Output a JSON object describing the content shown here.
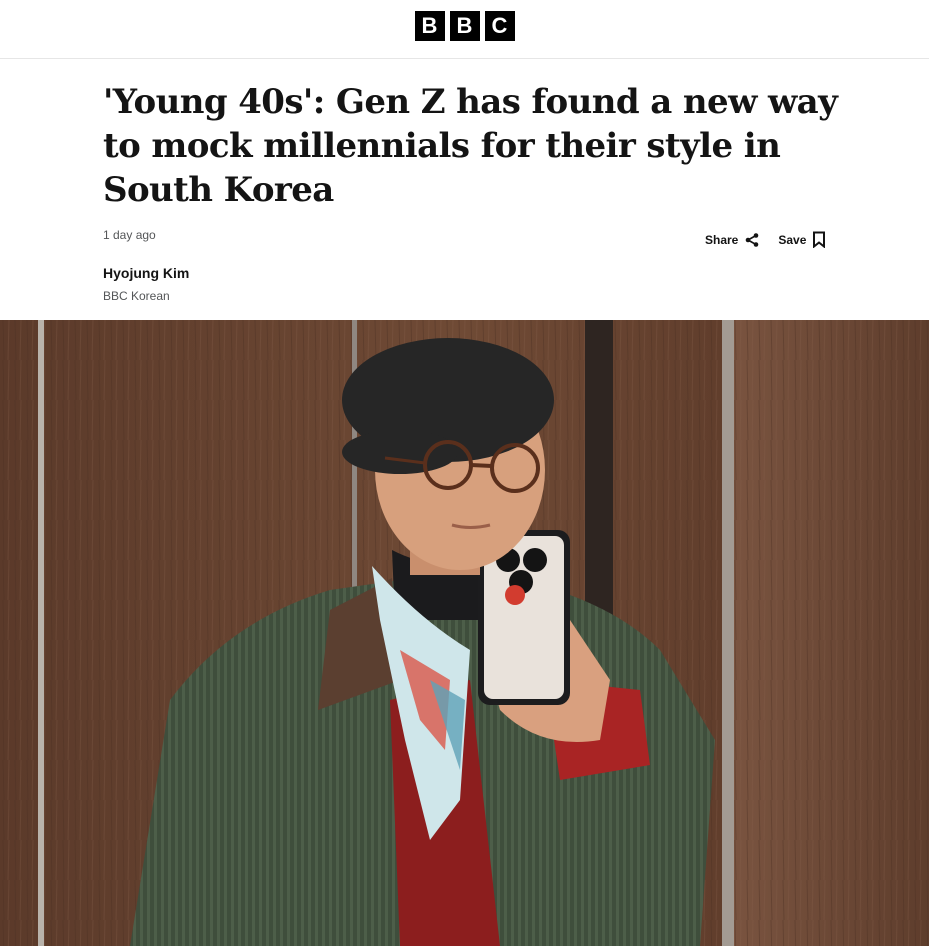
{
  "brand": {
    "letters": [
      "B",
      "B",
      "C"
    ]
  },
  "article": {
    "headline": "'Young 40s': Gen Z has found a new way to mock millennials for their style in South Korea",
    "timestamp": "1 day ago",
    "author": "Hyojung Kim",
    "organization": "BBC Korean"
  },
  "actions": {
    "share_label": "Share",
    "save_label": "Save"
  },
  "icons": {
    "share": "share-icon",
    "save": "bookmark-icon"
  }
}
